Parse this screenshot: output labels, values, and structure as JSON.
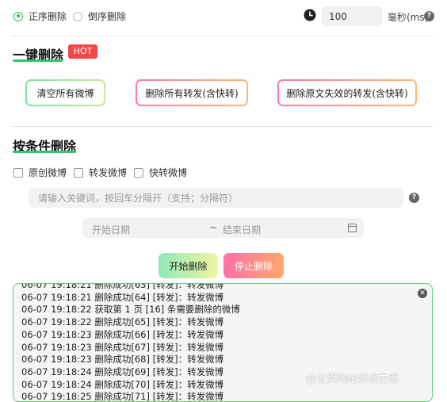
{
  "order": {
    "options": [
      {
        "label": "正序删除",
        "checked": true
      },
      {
        "label": "倒序删除",
        "checked": false
      }
    ]
  },
  "delay": {
    "value": "100",
    "unit": "毫秒(ms)"
  },
  "quick_delete": {
    "title": "一键删除",
    "badge": "HOT",
    "buttons": [
      {
        "label": "清空所有微博"
      },
      {
        "label": "删除所有转发(含快转)"
      },
      {
        "label": "删除原文失效的转发(含快转)"
      }
    ]
  },
  "conditional_delete": {
    "title": "按条件删除",
    "types": [
      {
        "label": "原创微博",
        "checked": false
      },
      {
        "label": "转发微博",
        "checked": false
      },
      {
        "label": "快转微博",
        "checked": false
      }
    ],
    "keyword_placeholder": "请输入关键词，按回车分隔开（支持；分隔符）",
    "start_date_placeholder": "开始日期",
    "date_separator": "~",
    "end_date_placeholder": "结束日期",
    "start_button": "开始删除",
    "stop_button": "停止删除"
  },
  "log": {
    "lines": [
      "06-07 19:18:21 删除成功[63] [转发]：转发微博",
      "06-07 19:18:21 删除成功[64] [转发]：转发微博",
      "06-07 19:18:22 获取第 1 页 [16] 条需要删除的微博",
      "06-07 19:18:22 删除成功[65] [转发]：转发微博",
      "06-07 19:18:23 删除成功[66] [转发]：转发微博",
      "06-07 19:18:23 删除成功[67] [转发]：转发微博",
      "06-07 19:18:23 删除成功[68] [转发]：转发微博",
      "06-07 19:18:24 删除成功[69] [转发]：转发微博",
      "06-07 19:18:24 删除成功[70] [转发]：转发微博",
      "06-07 19:18:25 删除成功[71] [转发]：转发微博"
    ]
  },
  "watermark": "@太原网站建设杰思",
  "colors": {
    "accent": "#2bbf58",
    "hot": "#f04848",
    "start_gradient": [
      "#8fe9b6",
      "#f0f5a0"
    ],
    "stop_gradient": [
      "#ff6fa6",
      "#ffa86b"
    ]
  },
  "icons": {
    "clock": "clock-icon",
    "help": "question-icon",
    "calendar": "calendar-icon",
    "close": "close-icon"
  }
}
